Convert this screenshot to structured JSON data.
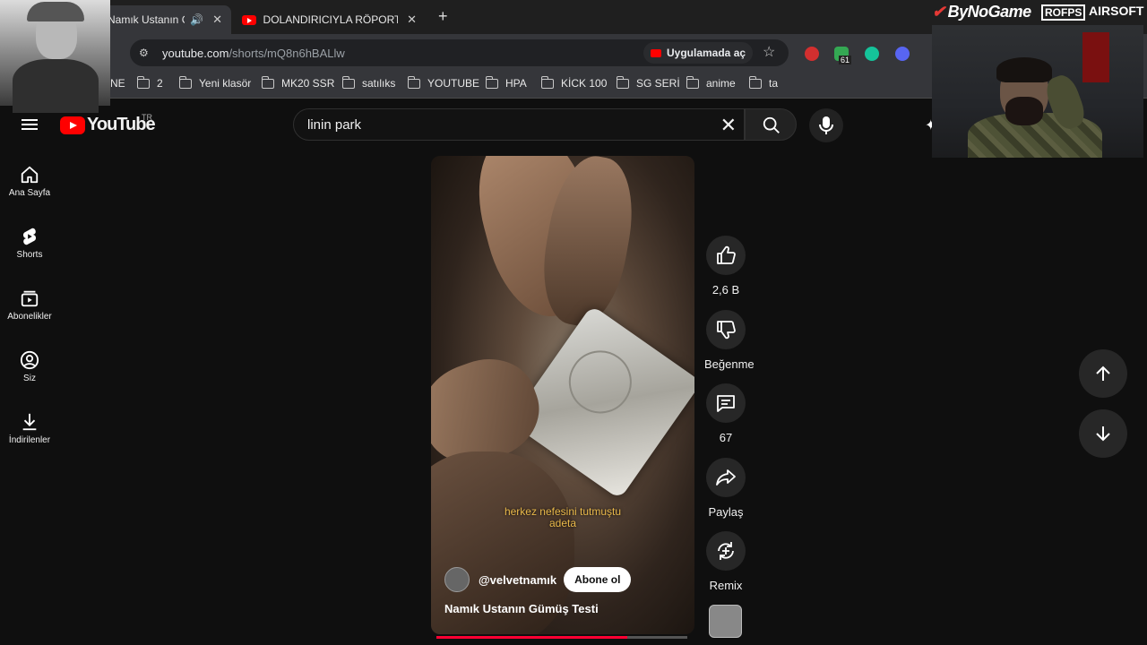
{
  "browser": {
    "tabs": [
      {
        "title": "Namık Ustanın Gümüş",
        "active": true
      },
      {
        "title": "DOLANDIRICIYLA RÖPORTAJ YA",
        "active": false
      }
    ],
    "new_tab_label": "+",
    "url_host": "youtube.com",
    "url_path": "/shorts/mQ8n6hBALlw",
    "open_in_app_label": "Uygulamada aç",
    "extension_badge": "61",
    "bookmarks": [
      "NE",
      "2",
      "Yeni klasör",
      "MK20 SSR",
      "satılıks",
      "YOUTUBE",
      "HPA",
      "KİCK 100",
      "SG SERİ",
      "anime",
      "ta"
    ]
  },
  "youtube": {
    "logo_text": "YouTube",
    "country_code": "TR",
    "search_query": "linin park",
    "nav": [
      {
        "label": "Ana Sayfa",
        "icon": "home-icon"
      },
      {
        "label": "Shorts",
        "icon": "shorts-icon"
      },
      {
        "label": "Abonelikler",
        "icon": "subscriptions-icon"
      },
      {
        "label": "Siz",
        "icon": "you-icon"
      },
      {
        "label": "İndirilenler",
        "icon": "downloads-icon"
      }
    ]
  },
  "short": {
    "caption_line1": "herkez nefesini tutmuştu",
    "caption_line2": "adeta",
    "channel_handle": "@velvetnamık",
    "subscribe_label": "Abone ol",
    "title": "Namık Ustanın Gümüş Testi",
    "progress": 0.76,
    "actions": {
      "likes": "2,6 B",
      "dislike_label": "Beğenme",
      "comments": "67",
      "share_label": "Paylaş",
      "remix_label": "Remix"
    }
  },
  "overlay": {
    "brand_name": "ByNoGame",
    "brand2_a": "ROFPS",
    "brand2_b": "AIRSOFT"
  },
  "colors": {
    "accent_red": "#ff0000",
    "progress_red": "#ff0033",
    "caption_yellow": "#e8b84a",
    "background": "#0f0f0f"
  }
}
